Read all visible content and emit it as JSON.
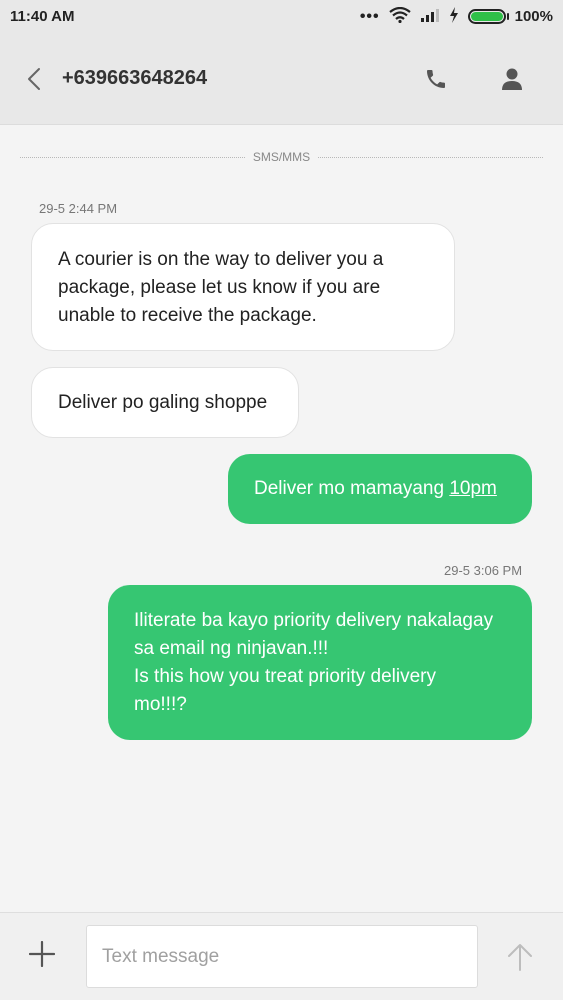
{
  "status_bar": {
    "time": "11:40 AM",
    "battery": "100%",
    "battery_level": 1.0,
    "icons": [
      "more-dots-icon",
      "wifi-icon",
      "signal-icon",
      "charging-icon",
      "battery-icon"
    ]
  },
  "header": {
    "title": "+639663648264",
    "icons": [
      "back-arrow-icon",
      "phone-icon",
      "contact-icon"
    ]
  },
  "conversation": {
    "divider_label": "SMS/MMS",
    "timestamps": [
      "29-5 2:44 PM",
      "29-5 3:06 PM"
    ],
    "messages": [
      {
        "direction": "incoming",
        "lines": [
          "A courier is on the way to deliver you a",
          "package, please let us know if you are",
          "unable to receive the package."
        ]
      },
      {
        "direction": "incoming",
        "lines": [
          "Deliver po galing shoppe"
        ]
      },
      {
        "direction": "outgoing",
        "text": "Deliver mo mamayang ",
        "link": "10pm"
      },
      {
        "direction": "outgoing",
        "lines": [
          "Iliterate ba kayo priority delivery nakalagay",
          "sa email ng ninjavan.!!!",
          "Is this how you treat priority delivery",
          "mo!!!?"
        ]
      }
    ]
  },
  "composer": {
    "placeholder": "Text message",
    "value": "",
    "icons": [
      "plus-icon",
      "send-arrow-icon"
    ]
  },
  "colors": {
    "outgoing_bubble": "#36c672",
    "incoming_bubble": "#ffffff",
    "background": "#f4f4f4",
    "bar": "#e8e8e8",
    "battery_fill": "#2fbf48"
  }
}
